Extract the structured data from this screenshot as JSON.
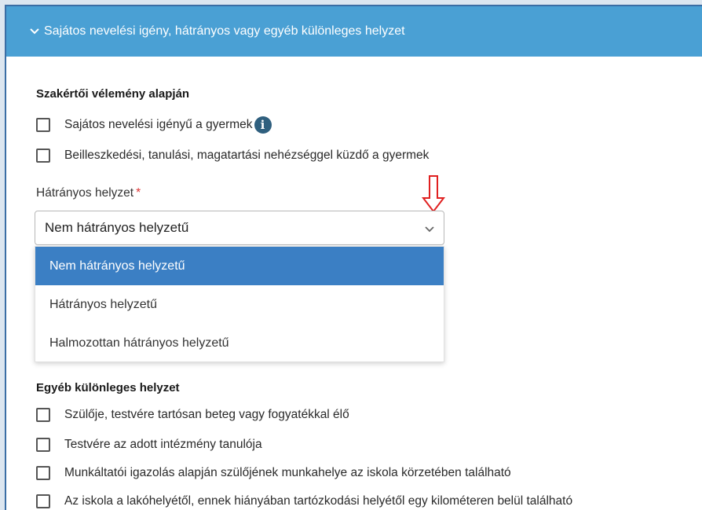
{
  "panel": {
    "title": "Sajátos nevelési igény, hátrányos vagy egyéb különleges helyzet"
  },
  "expert_section": {
    "title": "Szakértői vélemény alapján",
    "items": [
      {
        "label": "Sajátos nevelési igényű a gyermek",
        "checked": false,
        "has_info_icon": true
      },
      {
        "label": "Beilleszkedési, tanulási, magatartási nehézséggel küzdő a gyermek",
        "checked": false
      }
    ],
    "info_glyph": "i"
  },
  "disadvantage": {
    "label": "Hátrányos helyzet",
    "required_mark": "*",
    "selected_value": "Nem hátrányos helyzetű",
    "options": [
      "Nem hátrányos helyzetű",
      "Hátrányos helyzetű",
      "Halmozottan hátrányos helyzetű"
    ],
    "highlighted_index": 0
  },
  "other_section": {
    "title": "Egyéb különleges helyzet",
    "items": [
      {
        "label": "Szülője, testvére tartósan beteg vagy fogyatékkal élő",
        "checked": false
      },
      {
        "label": "Testvére az adott intézmény tanulója",
        "checked": false
      },
      {
        "label": "Munkáltatói igazolás alapján szülőjének munkahelye az iskola körzetében található",
        "checked": false
      },
      {
        "label": "Az iskola a lakóhelyétől, ennek hiányában tartózkodási helyétől egy kilométeren belül található",
        "checked": false
      }
    ]
  },
  "colors": {
    "header_bg": "#4aa0d4",
    "selected_option_bg": "#3b7fc4",
    "annotation_arrow": "#e02020",
    "info_icon_bg": "#2f5f7e"
  },
  "icons": {
    "header_toggle": "chevron-down-icon",
    "select_caret": "chevron-down-icon",
    "info": "info-icon",
    "annotation": "red-down-arrow-icon"
  }
}
